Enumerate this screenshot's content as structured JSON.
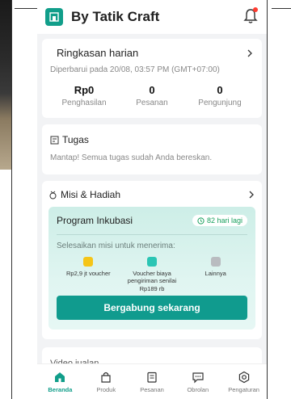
{
  "header": {
    "store_name": "By Tatik Craft"
  },
  "summary": {
    "title": "Ringkasan harian",
    "updated": "Diperbarui pada 20/08, 03:57 PM (GMT+07:00)",
    "stats": [
      {
        "value": "Rp0",
        "label": "Penghasilan"
      },
      {
        "value": "0",
        "label": "Pesanan"
      },
      {
        "value": "0",
        "label": "Pengunjung"
      }
    ]
  },
  "tasks": {
    "title": "Tugas",
    "message": "Mantap! Semua tugas sudah Anda bereskan."
  },
  "missions": {
    "title": "Misi & Hadiah",
    "program": {
      "title": "Program Inkubasi",
      "days_badge": "82 hari lagi",
      "subtitle": "Selesaikan misi untuk menerima:",
      "rewards": [
        {
          "label": "Rp2,9 jt voucher"
        },
        {
          "label": "Voucher biaya pengiriman senilai Rp189 rb"
        },
        {
          "label": "Lainnya"
        }
      ],
      "cta": "Bergabung sekarang"
    }
  },
  "video": {
    "title": "Video jualan"
  },
  "nav": {
    "items": [
      {
        "label": "Beranda"
      },
      {
        "label": "Produk"
      },
      {
        "label": "Pesanan"
      },
      {
        "label": "Obrolan"
      },
      {
        "label": "Pengaturan"
      }
    ]
  },
  "colors": {
    "accent": "#119e8a",
    "badge_green": "#18a05d",
    "notif_red": "#ff3b30"
  }
}
